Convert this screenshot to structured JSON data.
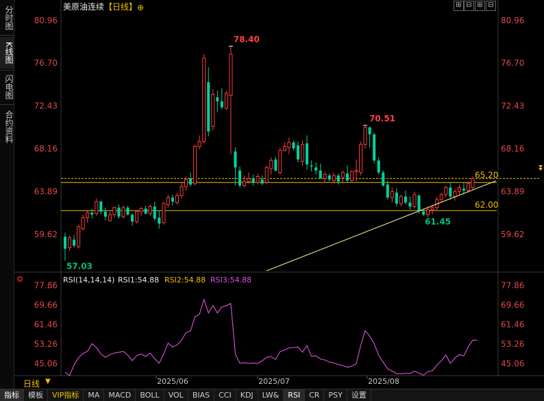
{
  "sidebar": {
    "tabs": [
      {
        "label": "分时图",
        "active": false
      },
      {
        "label": "K线图",
        "active": true
      },
      {
        "label": "闪电图",
        "active": false
      },
      {
        "label": "合约资料",
        "active": false
      }
    ]
  },
  "header": {
    "title": "美原油连续",
    "period_bracket": "【日线】",
    "add_symbol": "⊕",
    "window_controls": [
      "⊞",
      "⊟",
      "⊞",
      "⊟"
    ]
  },
  "price_axis": {
    "labels": [
      "80.96",
      "76.70",
      "72.43",
      "68.16",
      "63.89",
      "59.62"
    ]
  },
  "annotations": {
    "high": "78.40",
    "peak2": "70.51",
    "low": "57.03",
    "recent_low": "61.45",
    "current": "65.20",
    "support": "62.00"
  },
  "rsi_panel": {
    "title": "RSI(14,14,14)",
    "rsi1": "RSI1:54.88",
    "rsi2": "RSI2:54.88",
    "rsi3": "RSI3:54.88",
    "axis_labels": [
      "77.86",
      "69.66",
      "61.46",
      "53.26",
      "45.06"
    ],
    "settings_icon": "gear-icon"
  },
  "x_axis": {
    "labels": [
      "2025/06",
      "2025/07",
      "2025/08"
    ]
  },
  "period": {
    "label": "日线",
    "arrow": "▼"
  },
  "bottom_tabs": [
    {
      "label": "指标",
      "active": true
    },
    {
      "label": "模板",
      "active": false
    },
    {
      "label": "VIP指标",
      "active": false,
      "color": "#f0c000"
    },
    {
      "label": "MA",
      "active": false
    },
    {
      "label": "MACD",
      "active": false
    },
    {
      "label": "BOLL",
      "active": false
    },
    {
      "label": "VOL",
      "active": false
    },
    {
      "label": "BIAS",
      "active": false
    },
    {
      "label": "CCI",
      "active": false
    },
    {
      "label": "KDJ",
      "active": false
    },
    {
      "label": "LW&",
      "active": false
    },
    {
      "label": "RSI",
      "active": true
    },
    {
      "label": "CR",
      "active": false
    },
    {
      "label": "PSY",
      "active": false
    },
    {
      "label": "设置",
      "active": false
    }
  ],
  "chart_data": [
    {
      "type": "candlestick",
      "title": "美原油连续【日线】",
      "ylim": [
        56.0,
        81.5
      ],
      "x_labels": [
        "2025/06",
        "2025/07",
        "2025/08"
      ],
      "candles": [
        {
          "o": 59.4,
          "h": 59.8,
          "l": 57.0,
          "c": 58.2
        },
        {
          "o": 58.3,
          "h": 59.5,
          "l": 58.0,
          "c": 59.3
        },
        {
          "o": 59.1,
          "h": 59.6,
          "l": 58.3,
          "c": 58.5
        },
        {
          "o": 58.4,
          "h": 60.6,
          "l": 58.2,
          "c": 60.4
        },
        {
          "o": 60.2,
          "h": 61.6,
          "l": 60.0,
          "c": 61.3
        },
        {
          "o": 61.3,
          "h": 62.0,
          "l": 60.8,
          "c": 61.8
        },
        {
          "o": 61.8,
          "h": 62.2,
          "l": 61.2,
          "c": 61.6
        },
        {
          "o": 61.7,
          "h": 63.2,
          "l": 61.5,
          "c": 62.9
        },
        {
          "o": 62.9,
          "h": 63.0,
          "l": 61.6,
          "c": 61.9
        },
        {
          "o": 61.9,
          "h": 62.3,
          "l": 61.0,
          "c": 61.4
        },
        {
          "o": 61.0,
          "h": 61.9,
          "l": 60.9,
          "c": 61.6
        },
        {
          "o": 61.6,
          "h": 62.4,
          "l": 61.3,
          "c": 62.3
        },
        {
          "o": 62.3,
          "h": 62.6,
          "l": 61.2,
          "c": 61.4
        },
        {
          "o": 61.4,
          "h": 62.5,
          "l": 61.2,
          "c": 62.3
        },
        {
          "o": 62.3,
          "h": 62.5,
          "l": 61.5,
          "c": 61.6
        },
        {
          "o": 61.6,
          "h": 61.7,
          "l": 60.5,
          "c": 60.9
        },
        {
          "o": 60.9,
          "h": 62.0,
          "l": 60.7,
          "c": 61.9
        },
        {
          "o": 61.9,
          "h": 62.4,
          "l": 61.5,
          "c": 62.2
        },
        {
          "o": 62.2,
          "h": 62.5,
          "l": 61.6,
          "c": 61.7
        },
        {
          "o": 61.7,
          "h": 62.6,
          "l": 61.5,
          "c": 62.4
        },
        {
          "o": 62.4,
          "h": 62.9,
          "l": 61.0,
          "c": 61.2
        },
        {
          "o": 61.3,
          "h": 62.0,
          "l": 60.2,
          "c": 60.7
        },
        {
          "o": 60.8,
          "h": 62.9,
          "l": 60.6,
          "c": 62.7
        },
        {
          "o": 62.6,
          "h": 63.6,
          "l": 62.3,
          "c": 63.3
        },
        {
          "o": 63.3,
          "h": 63.6,
          "l": 62.5,
          "c": 62.9
        },
        {
          "o": 62.8,
          "h": 63.8,
          "l": 62.6,
          "c": 63.5
        },
        {
          "o": 63.5,
          "h": 64.8,
          "l": 63.2,
          "c": 64.4
        },
        {
          "o": 64.4,
          "h": 65.4,
          "l": 64.0,
          "c": 65.1
        },
        {
          "o": 65.2,
          "h": 65.8,
          "l": 64.4,
          "c": 64.6
        },
        {
          "o": 64.7,
          "h": 68.6,
          "l": 64.5,
          "c": 68.4
        },
        {
          "o": 68.4,
          "h": 69.5,
          "l": 68.1,
          "c": 68.9
        },
        {
          "o": 68.9,
          "h": 77.6,
          "l": 68.7,
          "c": 77.2
        },
        {
          "o": 74.8,
          "h": 76.3,
          "l": 69.4,
          "c": 69.9
        },
        {
          "o": 70.4,
          "h": 74.1,
          "l": 70.0,
          "c": 73.6
        },
        {
          "o": 73.3,
          "h": 74.0,
          "l": 71.8,
          "c": 72.9
        },
        {
          "o": 72.9,
          "h": 74.2,
          "l": 72.1,
          "c": 72.3
        },
        {
          "o": 72.2,
          "h": 73.9,
          "l": 72.0,
          "c": 73.7
        },
        {
          "o": 73.5,
          "h": 78.4,
          "l": 67.6,
          "c": 77.6
        },
        {
          "o": 67.9,
          "h": 68.3,
          "l": 64.5,
          "c": 66.3
        },
        {
          "o": 66.0,
          "h": 66.4,
          "l": 64.3,
          "c": 64.5
        },
        {
          "o": 64.5,
          "h": 65.5,
          "l": 64.3,
          "c": 64.9
        },
        {
          "o": 64.9,
          "h": 65.8,
          "l": 64.7,
          "c": 65.2
        },
        {
          "o": 65.2,
          "h": 65.6,
          "l": 64.5,
          "c": 64.8
        },
        {
          "o": 64.8,
          "h": 65.7,
          "l": 64.6,
          "c": 65.4
        },
        {
          "o": 65.1,
          "h": 65.5,
          "l": 64.5,
          "c": 64.7
        },
        {
          "o": 64.8,
          "h": 66.5,
          "l": 64.6,
          "c": 66.3
        },
        {
          "o": 66.2,
          "h": 67.3,
          "l": 65.6,
          "c": 67.0
        },
        {
          "o": 67.1,
          "h": 67.4,
          "l": 65.9,
          "c": 66.0
        },
        {
          "o": 65.8,
          "h": 68.3,
          "l": 65.6,
          "c": 68.0
        },
        {
          "o": 68.0,
          "h": 68.8,
          "l": 67.9,
          "c": 68.4
        },
        {
          "o": 68.3,
          "h": 69.3,
          "l": 67.6,
          "c": 68.8
        },
        {
          "o": 68.8,
          "h": 69.0,
          "l": 68.0,
          "c": 68.2
        },
        {
          "o": 68.5,
          "h": 68.9,
          "l": 66.8,
          "c": 67.1
        },
        {
          "o": 66.9,
          "h": 69.0,
          "l": 66.5,
          "c": 68.6
        },
        {
          "o": 68.7,
          "h": 69.5,
          "l": 66.1,
          "c": 66.6
        },
        {
          "o": 66.5,
          "h": 67.0,
          "l": 65.9,
          "c": 66.4
        },
        {
          "o": 66.3,
          "h": 66.8,
          "l": 65.6,
          "c": 66.0
        },
        {
          "o": 66.0,
          "h": 66.7,
          "l": 65.2,
          "c": 65.2
        },
        {
          "o": 65.2,
          "h": 65.9,
          "l": 64.8,
          "c": 65.6
        },
        {
          "o": 65.5,
          "h": 65.7,
          "l": 64.9,
          "c": 65.1
        },
        {
          "o": 65.0,
          "h": 65.8,
          "l": 64.7,
          "c": 65.5
        },
        {
          "o": 65.5,
          "h": 65.7,
          "l": 64.6,
          "c": 64.9
        },
        {
          "o": 65.3,
          "h": 66.0,
          "l": 64.7,
          "c": 65.8
        },
        {
          "o": 65.7,
          "h": 66.5,
          "l": 64.8,
          "c": 65.0
        },
        {
          "o": 65.0,
          "h": 66.0,
          "l": 64.8,
          "c": 65.9
        },
        {
          "o": 65.9,
          "h": 67.1,
          "l": 64.9,
          "c": 66.0
        },
        {
          "o": 65.8,
          "h": 68.9,
          "l": 65.5,
          "c": 68.6
        },
        {
          "o": 68.6,
          "h": 70.5,
          "l": 68.2,
          "c": 70.3
        },
        {
          "o": 70.3,
          "h": 70.4,
          "l": 68.3,
          "c": 69.6
        },
        {
          "o": 69.6,
          "h": 69.8,
          "l": 66.7,
          "c": 67.0
        },
        {
          "o": 67.0,
          "h": 67.3,
          "l": 65.6,
          "c": 65.8
        },
        {
          "o": 65.8,
          "h": 66.0,
          "l": 64.4,
          "c": 64.5
        },
        {
          "o": 64.6,
          "h": 65.0,
          "l": 63.1,
          "c": 63.3
        },
        {
          "o": 63.3,
          "h": 64.3,
          "l": 62.8,
          "c": 63.9
        },
        {
          "o": 63.8,
          "h": 64.2,
          "l": 62.4,
          "c": 62.7
        },
        {
          "o": 62.7,
          "h": 63.6,
          "l": 62.4,
          "c": 63.4
        },
        {
          "o": 63.4,
          "h": 64.0,
          "l": 62.6,
          "c": 62.8
        },
        {
          "o": 62.8,
          "h": 63.4,
          "l": 62.1,
          "c": 62.4
        },
        {
          "o": 62.4,
          "h": 63.9,
          "l": 62.2,
          "c": 63.6
        },
        {
          "o": 63.5,
          "h": 63.6,
          "l": 61.7,
          "c": 62.0
        },
        {
          "o": 61.9,
          "h": 62.2,
          "l": 61.45,
          "c": 61.6
        },
        {
          "o": 61.6,
          "h": 62.4,
          "l": 61.3,
          "c": 62.1
        },
        {
          "o": 62.1,
          "h": 62.5,
          "l": 61.6,
          "c": 62.3
        },
        {
          "o": 62.3,
          "h": 63.4,
          "l": 62.0,
          "c": 63.1
        },
        {
          "o": 63.1,
          "h": 63.8,
          "l": 62.8,
          "c": 63.6
        },
        {
          "o": 63.6,
          "h": 64.5,
          "l": 63.3,
          "c": 64.3
        },
        {
          "o": 64.3,
          "h": 64.8,
          "l": 63.1,
          "c": 63.4
        },
        {
          "o": 63.4,
          "h": 64.2,
          "l": 63.0,
          "c": 63.9
        },
        {
          "o": 63.9,
          "h": 64.6,
          "l": 63.5,
          "c": 64.3
        },
        {
          "o": 64.2,
          "h": 64.8,
          "l": 63.6,
          "c": 64.0
        },
        {
          "o": 64.0,
          "h": 64.9,
          "l": 63.8,
          "c": 64.7
        },
        {
          "o": 64.3,
          "h": 65.4,
          "l": 64.1,
          "c": 65.2
        }
      ],
      "lines": [
        {
          "name": "current",
          "y": 65.2
        },
        {
          "name": "resistance",
          "y": 64.8
        },
        {
          "name": "support",
          "y": 62.0
        }
      ],
      "trendline": {
        "from": [
          45,
          56.0
        ],
        "to": [
          92,
          64.7
        ]
      }
    },
    {
      "type": "line",
      "title": "RSI(14,14,14)",
      "ylim": [
        40.0,
        82.0
      ],
      "series": [
        {
          "name": "RSI1",
          "color": "#e050e0",
          "values": [
            41.5,
            40.0,
            44.5,
            47.5,
            49.3,
            50.2,
            53.4,
            51.8,
            49.1,
            47.7,
            48.8,
            49.5,
            49.8,
            50.2,
            48.6,
            46.3,
            48.4,
            49.1,
            48.0,
            49.5,
            47.1,
            45.2,
            49.0,
            53.7,
            52.0,
            52.9,
            54.9,
            58.1,
            58.8,
            64.7,
            65.8,
            72.0,
            66.3,
            69.4,
            66.3,
            68.8,
            69.4,
            70.3,
            49.1,
            45.2,
            45.4,
            45.1,
            45.3,
            45.1,
            46.2,
            47.7,
            48.0,
            46.8,
            50.1,
            50.7,
            51.7,
            51.8,
            52.0,
            49.8,
            52.6,
            48.1,
            48.3,
            47.0,
            46.6,
            45.7,
            45.3,
            44.7,
            44.2,
            43.5,
            44.0,
            45.0,
            52.7,
            58.9,
            56.6,
            53.4,
            48.5,
            45.7,
            42.9,
            41.9,
            40.9,
            40.8,
            41.0,
            40.9,
            41.9,
            41.0,
            40.2,
            41.7,
            42.1,
            44.5,
            46.2,
            48.7,
            45.1,
            47.4,
            48.8,
            48.3,
            52.1,
            54.9,
            54.88
          ]
        }
      ],
      "y_labels": [
        "77.86",
        "69.66",
        "61.46",
        "53.26",
        "45.06"
      ],
      "x_labels": [
        "2025/06",
        "2025/07",
        "2025/08"
      ]
    }
  ]
}
